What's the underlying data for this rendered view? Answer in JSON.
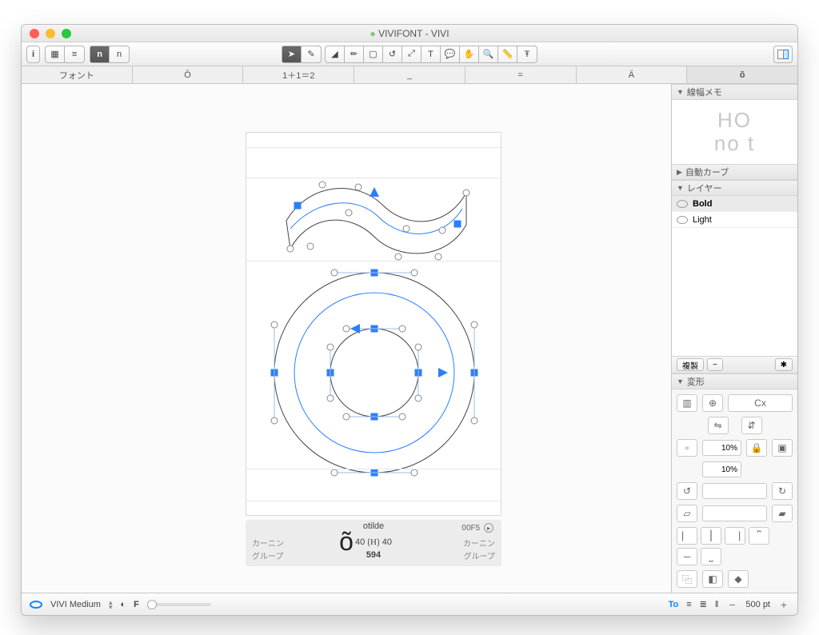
{
  "window": {
    "title": "VIVIFONT - VIVI"
  },
  "tabs": [
    "フォント",
    "Ō",
    "1＋1＝2",
    "_",
    "=",
    "Ä",
    "õ"
  ],
  "active_tab": 6,
  "sidebar": {
    "linewidth_header": "線幅メモ",
    "linewidth_preview": [
      "HO",
      "no  t"
    ],
    "auto_curve_header": "自動カーブ",
    "layer_header": "レイヤー",
    "layers": [
      "Bold",
      "Light"
    ],
    "layers_toolbar": {
      "duplicate": "複製",
      "minus": "−"
    },
    "transform_header": "変形",
    "transform_big_label": "Cx",
    "scale1": "10%",
    "scale2": "10%"
  },
  "glyph_info": {
    "name": "otilde",
    "unicode": "00F5",
    "kerning_label": "カーニン",
    "kerning_left": "40",
    "kerning_right": "40",
    "group_label": "グループ",
    "width": "594"
  },
  "preview_glyph": "õ",
  "status": {
    "master": "VIVI Medium",
    "f_label": "F",
    "to_label": "To",
    "size": "500 pt"
  }
}
